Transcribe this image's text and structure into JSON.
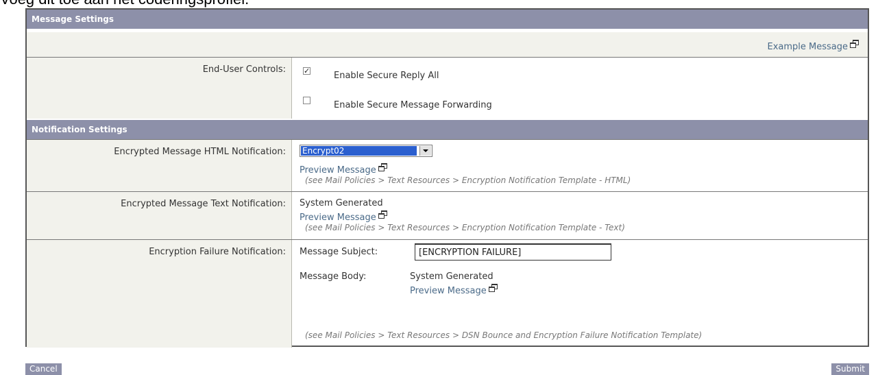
{
  "page_caption": "Voeg dit toe aan het coderingsprofiel.",
  "sections": {
    "message_settings": "Message Settings",
    "notification_settings": "Notification Settings"
  },
  "example_message_link": "Example Message",
  "end_user_controls": {
    "label": "End-User Controls:",
    "options": [
      {
        "label": "Enable Secure Reply All",
        "checked": true,
        "mark": "✓"
      },
      {
        "label": "Enable Secure Message Forwarding",
        "checked": false,
        "mark": ""
      }
    ]
  },
  "html_notification": {
    "label": "Encrypted Message HTML Notification:",
    "selected": "Encrypt02",
    "preview_link": "Preview Message",
    "hint": "(see Mail Policies > Text Resources > Encryption Notification Template - HTML)"
  },
  "text_notification": {
    "label": "Encrypted Message Text Notification:",
    "value": "System Generated",
    "preview_link": "Preview Message",
    "hint": "(see Mail Policies > Text Resources > Encryption Notification Template - Text)"
  },
  "failure_notification": {
    "label": "Encryption Failure Notification:",
    "subject_label": "Message Subject:",
    "subject_value": "[ENCRYPTION FAILURE]",
    "body_label": "Message Body:",
    "body_value": "System Generated",
    "preview_link": "Preview Message",
    "hint": "(see Mail Policies > Text Resources > DSN Bounce and Encryption Failure Notification Template)"
  },
  "buttons": {
    "cancel": "Cancel",
    "submit": "Submit"
  },
  "colors": {
    "header": "#8d90a9",
    "label_bg": "#f2f2ec",
    "link": "#4a6a88",
    "selected": "#2b5fcf"
  }
}
